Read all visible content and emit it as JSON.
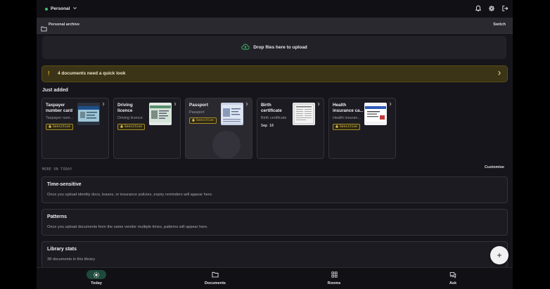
{
  "header": {
    "workspace": "Personal",
    "icons": [
      "bell-icon",
      "gear-icon",
      "logout-icon"
    ]
  },
  "subbar": {
    "archive_name": "Personal archive",
    "switch_label": "Switch"
  },
  "upload": {
    "label": "Drop files here to upload"
  },
  "alert": {
    "text": "4 documents need a quick look",
    "icon": "!",
    "color": "#e3b32e"
  },
  "just_added": {
    "title": "Just added",
    "cards": [
      {
        "title": "Taxpayer number card",
        "subtitle": "Taxpayer num...",
        "badge": "Sensitive"
      },
      {
        "title": "Driving licence",
        "subtitle": "Driving licence",
        "badge": "Sensitive"
      },
      {
        "title": "Passport",
        "subtitle": "Passport",
        "badge": "Sensitive"
      },
      {
        "title": "Birth certificate",
        "subtitle": "Birth certificate",
        "date": "Sep 18"
      },
      {
        "title": "Health insurance ca...",
        "subtitle": "Health insuran...",
        "badge": "Sensitive"
      }
    ]
  },
  "more": {
    "label": "MORE ON TODAY",
    "customise": "Customise",
    "panels": [
      {
        "title": "Time-sensitive",
        "desc": "Once you upload identity docs, leases, or insurance policies, expiry reminders will appear here."
      },
      {
        "title": "Patterns",
        "desc": "Once you upload documents from the same vendor multiple times, patterns will appear here."
      },
      {
        "title": "Library stats",
        "desc": "38 documents in this library"
      }
    ]
  },
  "fab": {
    "label": "+"
  },
  "nav": {
    "items": [
      {
        "label": "Today",
        "icon": "sun-icon"
      },
      {
        "label": "Documents",
        "icon": "folder-icon"
      },
      {
        "label": "Rooms",
        "icon": "grid-icon"
      },
      {
        "label": "Ask",
        "icon": "chat-icon"
      }
    ]
  },
  "colors": {
    "accent_green": "#3fbf6f",
    "sensitive": "#e6c85a",
    "background": "#16151b"
  }
}
